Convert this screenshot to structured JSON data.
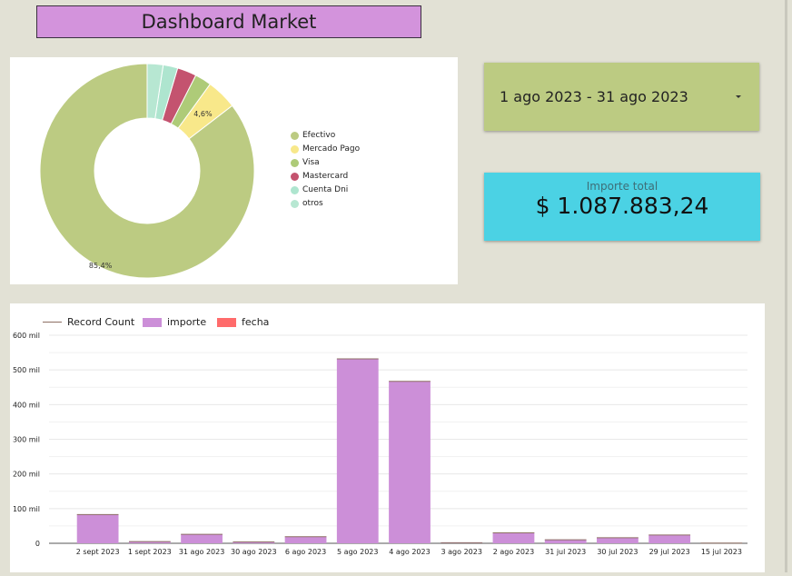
{
  "page": {
    "title": "Dashboard Market"
  },
  "date_filter": {
    "label": "1 ago 2023 - 31 ago 2023",
    "icon": "dropdown-caret-icon"
  },
  "kpi": {
    "label": "Importe total",
    "value": "$ 1.087.883,24"
  },
  "colors": {
    "background": "#e2e1d5",
    "title_bg": "#d393dc",
    "date_bg": "#bccb82",
    "kpi_bg": "#4bd2e4",
    "bar": "#cc8fd8",
    "record_count_line": "#8d6e63",
    "fecha": "#ff6b6b"
  },
  "chart_data": [
    {
      "type": "pie",
      "donut": true,
      "slices": [
        {
          "name": "Efectivo",
          "value": 85.4,
          "label": "85,4%",
          "color": "#bccb82"
        },
        {
          "name": "Mercado Pago",
          "value": 4.6,
          "label": "4,6%",
          "color": "#f8e88a"
        },
        {
          "name": "Visa",
          "value": 2.5,
          "label": "",
          "color": "#aecb78"
        },
        {
          "name": "Mastercard",
          "value": 2.9,
          "label": "",
          "color": "#c4536f"
        },
        {
          "name": "Cuenta Dni",
          "value": 2.2,
          "label": "",
          "color": "#aee5cf"
        },
        {
          "name": "otros",
          "value": 2.4,
          "label": "",
          "color": "#b7e7d2"
        }
      ],
      "legend": "right"
    },
    {
      "type": "bar",
      "legend": "top-left",
      "legend_items": [
        {
          "name": "Record Count",
          "kind": "line",
          "color": "#8d6e63"
        },
        {
          "name": "importe",
          "kind": "box",
          "color": "#cc8fd8"
        },
        {
          "name": "fecha",
          "kind": "box",
          "color": "#ff6b6b"
        }
      ],
      "categories": [
        "2 sept 2023",
        "1 sept 2023",
        "31 ago 2023",
        "30 ago 2023",
        "6 ago 2023",
        "5 ago 2023",
        "4 ago 2023",
        "3 ago 2023",
        "2 ago 2023",
        "31 jul 2023",
        "30 jul 2023",
        "29 jul 2023",
        "15 jul 2023"
      ],
      "series": [
        {
          "name": "importe",
          "values": [
            83000,
            5000,
            26000,
            4000,
            19000,
            532000,
            467000,
            1500,
            30000,
            10000,
            16000,
            24000,
            500
          ]
        }
      ],
      "ylim": [
        0,
        600000
      ],
      "y_ticks": [
        {
          "value": 600000,
          "label": "600 mil"
        },
        {
          "value": 500000,
          "label": "500 mil"
        },
        {
          "value": 400000,
          "label": "400 mil"
        },
        {
          "value": 300000,
          "label": "300 mil"
        },
        {
          "value": 200000,
          "label": "200 mil"
        },
        {
          "value": 100000,
          "label": "100 mil"
        },
        {
          "value": 0,
          "label": "0"
        }
      ],
      "grid": true
    }
  ]
}
